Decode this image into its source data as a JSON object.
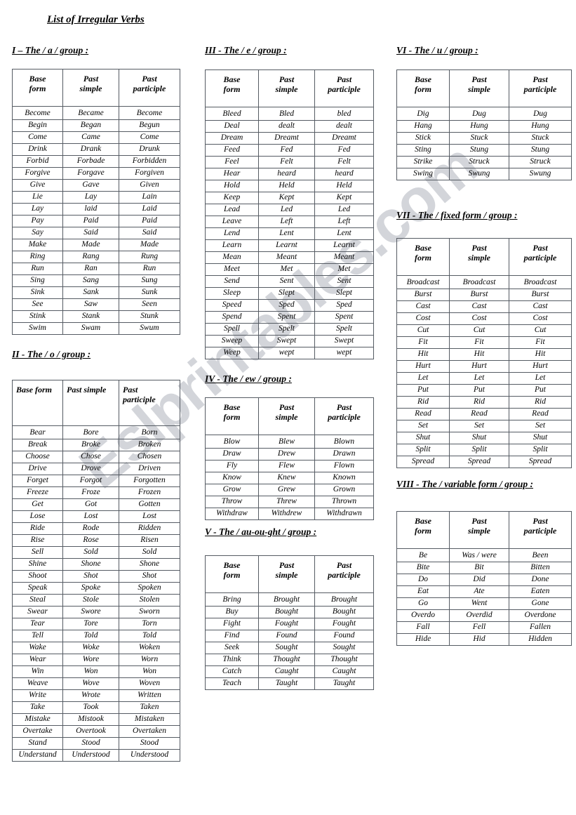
{
  "document": {
    "title": "List of  Irregular Verbs",
    "watermark": "Eslprintables.com"
  },
  "headers": {
    "base": "Base\nform",
    "base_1line": "Base form",
    "past_simple": "Past\nsimple",
    "past_simple_1line": "Past simple",
    "past_participle": "Past\nparticiple"
  },
  "sections": [
    {
      "id": "group-a",
      "heading": "I – The / a /  group :",
      "columns": [
        "Base form",
        "Past simple",
        "Past participle"
      ],
      "rows": [
        [
          "Become",
          "Became",
          "Become"
        ],
        [
          "Begin",
          "Began",
          "Begun"
        ],
        [
          "Come",
          "Came",
          "Come"
        ],
        [
          "Drink",
          "Drank",
          "Drunk"
        ],
        [
          "Forbid",
          "Forbade",
          "Forbidden"
        ],
        [
          "Forgive",
          "Forgave",
          "Forgiven"
        ],
        [
          "Give",
          "Gave",
          "Given"
        ],
        [
          "Lie",
          "Lay",
          "Lain"
        ],
        [
          "Lay",
          "laid",
          "Laid"
        ],
        [
          "Pay",
          "Paid",
          "Paid"
        ],
        [
          "Say",
          "Said",
          "Said"
        ],
        [
          "Make",
          "Made",
          "Made"
        ],
        [
          "Ring",
          "Rang",
          "Rung"
        ],
        [
          "Run",
          "Ran",
          "Run"
        ],
        [
          "Sing",
          "Sang",
          "Sung"
        ],
        [
          "Sink",
          "Sank",
          "Sunk"
        ],
        [
          "See",
          "Saw",
          "Seen"
        ],
        [
          "Stink",
          "Stank",
          "Stunk"
        ],
        [
          "Swim",
          "Swam",
          "Swum"
        ]
      ]
    },
    {
      "id": "group-o",
      "heading": "II -  The / o /  group :",
      "columns": [
        "Base form",
        "Past simple",
        "Past participle"
      ],
      "rows": [
        [
          "Bear",
          "Bore",
          "Born"
        ],
        [
          "Break",
          "Broke",
          "Broken"
        ],
        [
          "Choose",
          "Chose",
          "Chosen"
        ],
        [
          "Drive",
          "Drove",
          "Driven"
        ],
        [
          "Forget",
          "Forgot",
          "Forgotten"
        ],
        [
          "Freeze",
          "Froze",
          "Frozen"
        ],
        [
          "Get",
          "Got",
          "Gotten"
        ],
        [
          "Lose",
          "Lost",
          "Lost"
        ],
        [
          "Ride",
          "Rode",
          "Ridden"
        ],
        [
          "Rise",
          "Rose",
          "Risen"
        ],
        [
          "Sell",
          "Sold",
          "Sold"
        ],
        [
          "Shine",
          "Shone",
          "Shone"
        ],
        [
          "Shoot",
          "Shot",
          "Shot"
        ],
        [
          "Speak",
          "Spoke",
          "Spoken"
        ],
        [
          "Steal",
          "Stole",
          "Stolen"
        ],
        [
          "Swear",
          "Swore",
          "Sworn"
        ],
        [
          "Tear",
          "Tore",
          "Torn"
        ],
        [
          "Tell",
          "Told",
          "Told"
        ],
        [
          "Wake",
          "Woke",
          "Woken"
        ],
        [
          "Wear",
          "Wore",
          "Worn"
        ],
        [
          "Win",
          "Won",
          "Won"
        ],
        [
          "Weave",
          "Wove",
          "Woven"
        ],
        [
          "Write",
          "Wrote",
          "Written"
        ],
        [
          "Take",
          "Took",
          "Taken"
        ],
        [
          "Mistake",
          "Mistook",
          "Mistaken"
        ],
        [
          "Overtake",
          "Overtook",
          "Overtaken"
        ],
        [
          "Stand",
          "Stood",
          "Stood"
        ],
        [
          "Understand",
          "Understood",
          "Understood"
        ]
      ]
    },
    {
      "id": "group-e",
      "heading": "III - The /  e  /  group :",
      "columns": [
        "Base form",
        "Past simple",
        "Past participle"
      ],
      "rows": [
        [
          "Bleed",
          "Bled",
          "bled"
        ],
        [
          "Deal",
          "dealt",
          "dealt"
        ],
        [
          "Dream",
          "Dreamt",
          "Dreamt"
        ],
        [
          "Feed",
          "Fed",
          "Fed"
        ],
        [
          "Feel",
          "Felt",
          "Felt"
        ],
        [
          "Hear",
          "heard",
          "heard"
        ],
        [
          "Hold",
          "Held",
          "Held"
        ],
        [
          "Keep",
          "Kept",
          "Kept"
        ],
        [
          "Lead",
          "Led",
          "Led"
        ],
        [
          "Leave",
          "Left",
          "Left"
        ],
        [
          "Lend",
          "Lent",
          "Lent"
        ],
        [
          "Learn",
          "Learnt",
          "Learnt"
        ],
        [
          "Mean",
          "Meant",
          "Meant"
        ],
        [
          "Meet",
          "Met",
          "Met"
        ],
        [
          "Send",
          "Sent",
          "Sent"
        ],
        [
          "Sleep",
          "Slept",
          "Slept"
        ],
        [
          "Speed",
          "Sped",
          "Sped"
        ],
        [
          "Spend",
          "Spent",
          "Spent"
        ],
        [
          "Spell",
          "Spelt",
          "Spelt"
        ],
        [
          "Sweep",
          "Swept",
          "Swept"
        ],
        [
          "Weep",
          "wept",
          "wept"
        ]
      ]
    },
    {
      "id": "group-ew",
      "heading": "IV -  The / ew /  group :",
      "columns": [
        "Base form",
        "Past simple",
        "Past participle"
      ],
      "rows": [
        [
          "Blow",
          "Blew",
          "Blown"
        ],
        [
          "Draw",
          "Drew",
          "Drawn"
        ],
        [
          "Fly",
          "Flew",
          "Flown"
        ],
        [
          "Know",
          "Knew",
          "Known"
        ],
        [
          "Grow",
          "Grew",
          "Grown"
        ],
        [
          "Throw",
          "Threw",
          "Thrown"
        ],
        [
          "Withdraw",
          "Withdrew",
          "Withdrawn"
        ]
      ]
    },
    {
      "id": "group-au-ou-ght",
      "heading": "V -  The  / au-ou-ght  /  group :",
      "columns": [
        "Base form",
        "Past simple",
        "Past participle"
      ],
      "rows": [
        [
          "Bring",
          "Brought",
          "Brought"
        ],
        [
          "Buy",
          "Bought",
          "Bought"
        ],
        [
          "Fight",
          "Fought",
          "Fought"
        ],
        [
          "Find",
          "Found",
          "Found"
        ],
        [
          "Seek",
          "Sought",
          "Sought"
        ],
        [
          "Think",
          "Thought",
          "Thought"
        ],
        [
          "Catch",
          "Caught",
          "Caught"
        ],
        [
          "Teach",
          "Taught",
          "Taught"
        ]
      ]
    },
    {
      "id": "group-u",
      "heading": "VI -  The / u /  group :",
      "columns": [
        "Base form",
        "Past simple",
        "Past participle"
      ],
      "rows": [
        [
          "Dig",
          "Dug",
          "Dug"
        ],
        [
          "Hang",
          "Hung",
          "Hung"
        ],
        [
          "Stick",
          "Stuck",
          "Stuck"
        ],
        [
          "Sting",
          "Stung",
          "Stung"
        ],
        [
          "Strike",
          "Struck",
          "Struck"
        ],
        [
          "Swing",
          "Swung",
          "Swung"
        ]
      ]
    },
    {
      "id": "group-fixed-form",
      "heading": "VII -  The / fixed form / group :",
      "columns": [
        "Base form",
        "Past simple",
        "Past participle"
      ],
      "rows": [
        [
          "Broadcast",
          "Broadcast",
          "Broadcast"
        ],
        [
          "Burst",
          "Burst",
          "Burst"
        ],
        [
          "Cast",
          "Cast",
          "Cast"
        ],
        [
          "Cost",
          "Cost",
          "Cost"
        ],
        [
          "Cut",
          "Cut",
          "Cut"
        ],
        [
          "Fit",
          "Fit",
          "Fit"
        ],
        [
          "Hit",
          "Hit",
          "Hit"
        ],
        [
          "Hurt",
          "Hurt",
          "Hurt"
        ],
        [
          "Let",
          "Let",
          "Let"
        ],
        [
          "Put",
          "Put",
          "Put"
        ],
        [
          "Rid",
          "Rid",
          "Rid"
        ],
        [
          "Read",
          "Read",
          "Read"
        ],
        [
          "Set",
          "Set",
          "Set"
        ],
        [
          "Shut",
          "Shut",
          "Shut"
        ],
        [
          "Split",
          "Split",
          "Split"
        ],
        [
          "Spread",
          "Spread",
          "Spread"
        ]
      ]
    },
    {
      "id": "group-variable-form",
      "heading": "VIII -   The  / variable form /  group :",
      "columns": [
        "Base form",
        "Past simple",
        "Past participle"
      ],
      "rows": [
        [
          "Be",
          "Was / were",
          "Been"
        ],
        [
          "Bite",
          "Bit",
          "Bitten"
        ],
        [
          "Do",
          "Did",
          "Done"
        ],
        [
          "Eat",
          "Ate",
          "Eaten"
        ],
        [
          "Go",
          "Went",
          "Gone"
        ],
        [
          "Overdo",
          "Overdid",
          "Overdone"
        ],
        [
          "Fall",
          "Fell",
          "Fallen"
        ],
        [
          "Hide",
          "Hid",
          "Hidden"
        ]
      ]
    }
  ]
}
